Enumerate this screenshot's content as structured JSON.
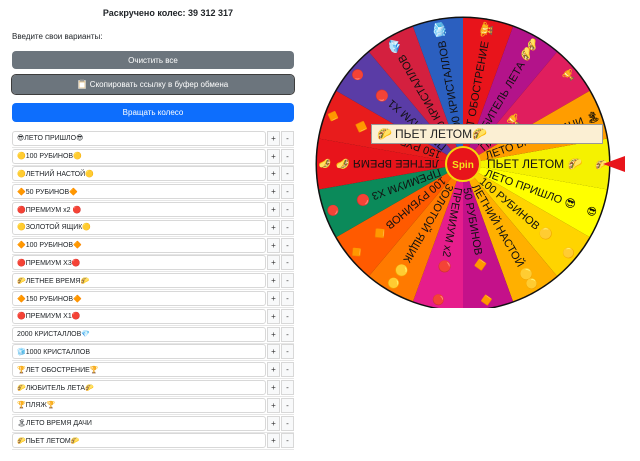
{
  "header": {
    "counter_text": "Раскручено колес: 39 312 317",
    "prompt": "Введите свои варианты:"
  },
  "buttons": {
    "clear_label": "Очистить все",
    "copy_icon": "clipboard-icon",
    "copy_label": "Скопировать ссылку в буфер обмена",
    "spin_label": "Вращать колесо"
  },
  "option_controls": {
    "plus": "+",
    "minus": "-"
  },
  "options": [
    {
      "text": "😎ЛЕТО ПРИШЛО😎"
    },
    {
      "text": "🟡100 РУБИНОВ🟡"
    },
    {
      "text": "🟡ЛЕТНИЙ НАСТОЙ🟡"
    },
    {
      "text": "🔶50 РУБИНОВ🔶"
    },
    {
      "text": "🔴ПРЕМИУМ х2 🔴"
    },
    {
      "text": "🟡ЗОЛОТОЙ ЯЩИК🟡"
    },
    {
      "text": "🔶100 РУБИНОВ🔶"
    },
    {
      "text": "🔴ПРЕМИУМ  Х3🔴"
    },
    {
      "text": "🌮ЛЕТНЕЕ ВРЕМЯ🌮"
    },
    {
      "text": "🔶150 РУБИНОВ🔶"
    },
    {
      "text": "🔴ПРЕМИУМ Х1🔴"
    },
    {
      "text": "2000 КРИСТАЛЛОВ💎"
    },
    {
      "text": "🧊1000 КРИСТАЛЛОВ"
    },
    {
      "text": "🏆ЛЕТ ОБОСТРЕНИЕ🏆"
    },
    {
      "text": "🌮ЛЮБИТЕЛЬ ЛЕТА🌮"
    },
    {
      "text": "🏆ПЛЯЖ🏆"
    },
    {
      "text": "🏝ЛЕТО ВРЕМЯ ДАЧИ"
    },
    {
      "text": "🌮ПЬЕТ ЛЕТОМ🌮"
    }
  ],
  "wheel": {
    "center_label": "Spin",
    "result_icon": "🌮",
    "result_text": "ПЬЕТ ЛЕТОМ",
    "colors": {
      "pointer": "#e8141b",
      "center": "#e8141b",
      "center_text": "#f5e31a"
    },
    "segments": [
      {
        "label": "ПЬЕТ ЛЕТОМ",
        "icon": "🌮",
        "color": "#f5f200"
      },
      {
        "label": "ЛЕТО ПРИШЛО",
        "icon": "😎",
        "color": "#ffff00"
      },
      {
        "label": "100 РУБИНОВ",
        "icon": "🟡",
        "color": "#ffd400"
      },
      {
        "label": "ЛЕТНИЙ НАСТОЙ",
        "icon": "🟡",
        "color": "#ffb000"
      },
      {
        "label": "50 РУБИНОВ",
        "icon": "🔶",
        "color": "#c4118a"
      },
      {
        "label": "ПРЕМИУМ х2",
        "icon": "🔴",
        "color": "#e61d8c"
      },
      {
        "label": "ЗОЛОТОЙ ЯЩИК",
        "icon": "🟡",
        "color": "#ff7a00"
      },
      {
        "label": "100 РУБИНОВ",
        "icon": "🔶",
        "color": "#ff5a00"
      },
      {
        "label": "ПРЕМИУМ Х3",
        "icon": "🔴",
        "color": "#0b8a5a"
      },
      {
        "label": "ЛЕТНЕЕ ВРЕМЯ",
        "icon": "🌮",
        "color": "#e8141b"
      },
      {
        "label": "150 РУБИНОВ",
        "icon": "🔶",
        "color": "#e81c1c"
      },
      {
        "label": "ПРЕМИУМ Х1",
        "icon": "🔴",
        "color": "#5a3ca6"
      },
      {
        "label": "2000 КРИСТАЛЛОВ",
        "icon": "💎",
        "color": "#d4203f"
      },
      {
        "label": "1000 КРИСТАЛЛОВ",
        "icon": "🧊",
        "color": "#2b5fbf"
      },
      {
        "label": "ЛЕТ ОБОСТРЕНИЕ",
        "icon": "🏆",
        "color": "#e8141b"
      },
      {
        "label": "ЛЮБИТЕЛЬ ЛЕТА",
        "icon": "🌮",
        "color": "#b3138a"
      },
      {
        "label": "ПЛЯЖ",
        "icon": "🏆",
        "color": "#e01e5e"
      },
      {
        "label": "ЛЕТО ВРЕМЯ ДАЧИ",
        "icon": "🏝",
        "color": "#ff9d00"
      }
    ]
  }
}
